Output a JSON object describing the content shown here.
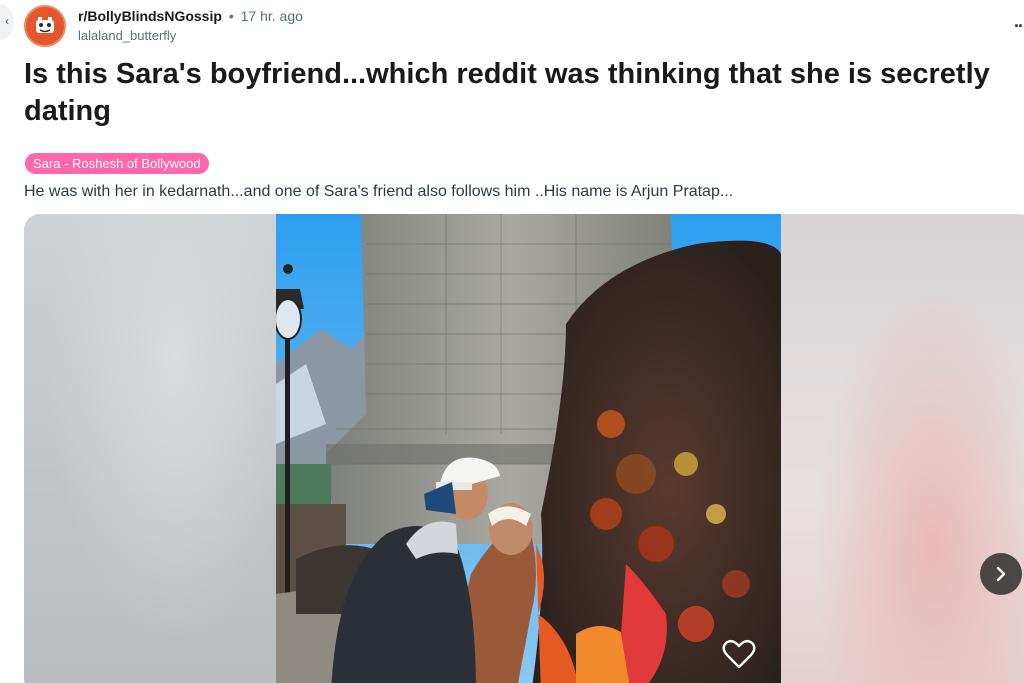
{
  "post": {
    "subreddit": "r/BollyBlindsNGossip",
    "separator": "•",
    "time": "17 hr. ago",
    "username": "lalaland_butterfly",
    "title": "Is this Sara's boyfriend...which reddit was thinking that she is secretly dating",
    "flair": "Sara - Roshesh of Bollywood",
    "body": "He was with her in kedarnath...and one of Sara's friend also follows him ..His name is Arjun Pratap...",
    "overflow_menu": "··"
  },
  "icons": {
    "avatar": "subreddit-avatar-icon",
    "next": "chevron-right-icon",
    "heart": "heart-icon",
    "menu": "overflow-menu-icon",
    "back": "chevron-left-icon"
  },
  "colors": {
    "flair_bg": "#ff66ac",
    "avatar_bg": "#e4572e",
    "meta_gray": "#576f76"
  }
}
